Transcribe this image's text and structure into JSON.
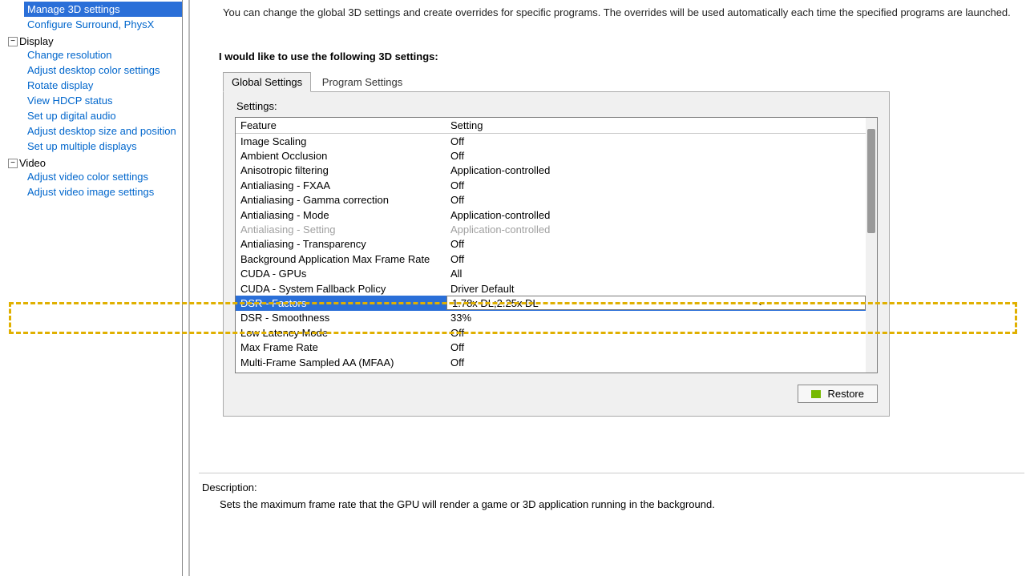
{
  "sidebar": {
    "manage3d": "Manage 3D settings",
    "configSurround": "Configure Surround, PhysX",
    "displayGroup": "Display",
    "displayItems": [
      "Change resolution",
      "Adjust desktop color settings",
      "Rotate display",
      "View HDCP status",
      "Set up digital audio",
      "Adjust desktop size and position",
      "Set up multiple displays"
    ],
    "videoGroup": "Video",
    "videoItems": [
      "Adjust video color settings",
      "Adjust video image settings"
    ]
  },
  "intro": "You can change the global 3D settings and create overrides for specific programs. The overrides will be used automatically each time the specified programs are launched.",
  "sectionTitle": "I would like to use the following 3D settings:",
  "tabs": {
    "global": "Global Settings",
    "program": "Program Settings"
  },
  "settingsLabel": "Settings:",
  "columns": {
    "feature": "Feature",
    "setting": "Setting"
  },
  "rows": [
    {
      "f": "Image Scaling",
      "s": "Off"
    },
    {
      "f": "Ambient Occlusion",
      "s": "Off"
    },
    {
      "f": "Anisotropic filtering",
      "s": "Application-controlled"
    },
    {
      "f": "Antialiasing - FXAA",
      "s": "Off"
    },
    {
      "f": "Antialiasing - Gamma correction",
      "s": "Off"
    },
    {
      "f": "Antialiasing - Mode",
      "s": "Application-controlled"
    },
    {
      "f": "Antialiasing - Setting",
      "s": "Application-controlled",
      "disabled": true
    },
    {
      "f": "Antialiasing - Transparency",
      "s": "Off"
    },
    {
      "f": "Background Application Max Frame Rate",
      "s": "Off"
    },
    {
      "f": "CUDA - GPUs",
      "s": "All"
    },
    {
      "f": "CUDA - System Fallback Policy",
      "s": "Driver Default"
    },
    {
      "f": "DSR - Factors",
      "s": "1.78x DL;2.25x DL",
      "selected": true
    },
    {
      "f": "DSR - Smoothness",
      "s": "33%"
    },
    {
      "f": "Low Latency Mode",
      "s": "Off"
    },
    {
      "f": "Max Frame Rate",
      "s": "Off"
    },
    {
      "f": "Multi-Frame Sampled AA (MFAA)",
      "s": "Off"
    }
  ],
  "restore": "Restore",
  "description": {
    "label": "Description:",
    "text": "Sets the maximum frame rate that the GPU will render a game or 3D application running in the background."
  }
}
